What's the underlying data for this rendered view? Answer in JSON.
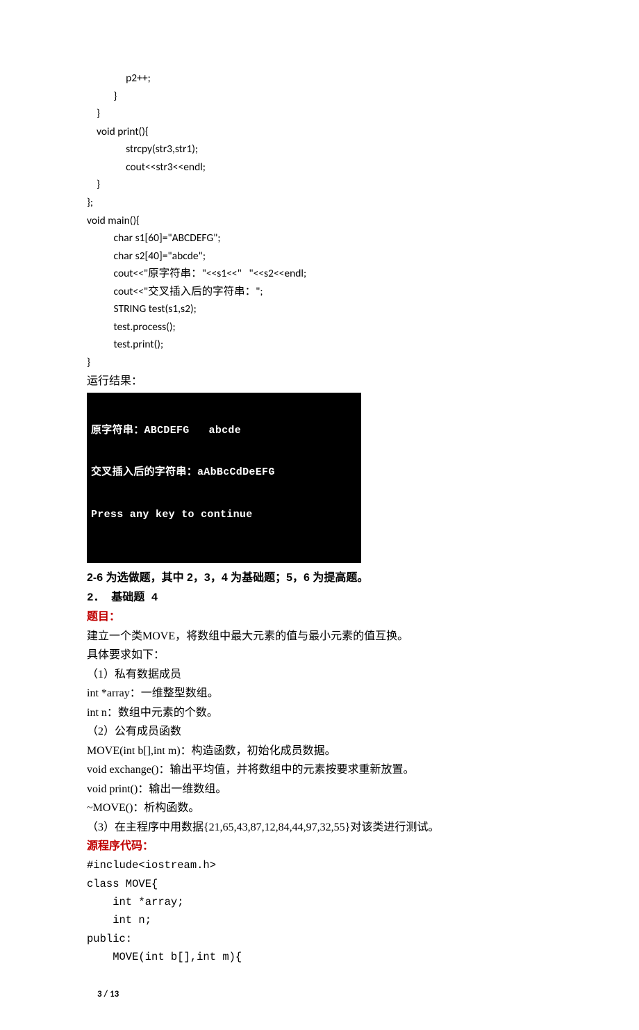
{
  "code_top": {
    "l01": "                p2++;",
    "l02": "           }",
    "l03": "    }",
    "l04": "    void print(){",
    "l05": "                strcpy(str3,str1);",
    "l06": "                cout<<str3<<endl;",
    "l07": "    }",
    "l08": "};",
    "l09": "void main(){",
    "l10": "           char s1[60]=\"ABCDEFG\";",
    "l11": "           char s2[40]=\"abcde\";",
    "l12": "           cout<<\"原字符串：\"<<s1<<\"   \"<<s2<<endl;",
    "l13": "           cout<<\"交叉插入后的字符串：\";",
    "l14": "           STRING test(s1,s2);",
    "l15": "           test.process();",
    "l16": "           test.print();",
    "l17": "}"
  },
  "run_label": "运行结果：",
  "console": {
    "l1": "原字符串：ABCDEFG   abcde",
    "l2": "交叉插入后的字符串：aAbBcCdDeEFG",
    "l3": "Press any key to continue"
  },
  "headings": {
    "sel": "2-6 为选做题，其中 2，3，4 为基础题；5，6 为提高题。",
    "q2": "2． 基础题 4",
    "timu": "题目：",
    "src": "源程序代码："
  },
  "desc": {
    "l1": "建立一个类MOVE，将数组中最大元素的值与最小元素的值互换。",
    "l2": "具体要求如下：",
    "l3": "（1）私有数据成员",
    "l4": " int *array：一维整型数组。",
    "l5": " int n：数组中元素的个数。",
    "l6": "（2）公有成员函数",
    "l7": " MOVE(int b[],int m)：构造函数，初始化成员数据。",
    "l8": " void exchange()：输出平均值，并将数组中的元素按要求重新放置。",
    "l9": " void print()：输出一维数组。",
    "l10": " ~MOVE()：析构函数。",
    "l11": "（3）在主程序中用数据{21,65,43,87,12,84,44,97,32,55}对该类进行测试。"
  },
  "code_bottom": {
    "l1": "#include<iostream.h>",
    "l2": "class MOVE{",
    "l3": "    int *array;",
    "l4": "    int n;",
    "l5": "public:",
    "l6": "    MOVE(int b[],int m){"
  },
  "footer": {
    "page": "3",
    "sep": " / ",
    "total": "13"
  }
}
